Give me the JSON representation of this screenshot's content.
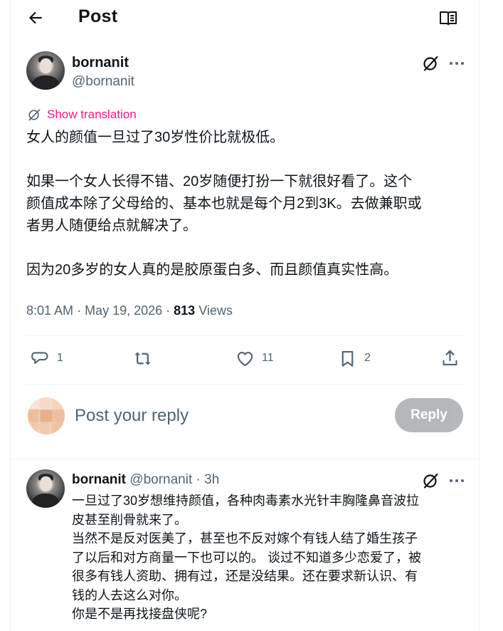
{
  "header": {
    "title": "Post"
  },
  "post": {
    "author_name": "bornanit",
    "author_handle": "@bornanit",
    "translate_label": "Show translation",
    "paragraphs": [
      [
        "女人的颜值一旦过了30岁性价比就极低。"
      ],
      [
        "如果一个女人长得不错、20岁随便打扮一下就很好看了。这个",
        "颜值成本除了父母给的、基本也就是每个月2到3K。去做兼职或",
        "者男人随便给点就解决了。"
      ],
      [
        "因为20多岁的女人真的是胶原蛋白多、而且颜值真实性高。"
      ]
    ],
    "time": "8:01 AM",
    "date": "May 19, 2026",
    "views_count": "813",
    "views_label": "Views",
    "stats": {
      "replies": "1",
      "reposts": "",
      "likes": "11",
      "bookmarks": "2"
    }
  },
  "reply_box": {
    "placeholder": "Post your reply",
    "button_label": "Reply"
  },
  "reply": {
    "author_name": "bornanit",
    "author_handle": "@bornanit",
    "time": "3h",
    "lines": [
      "一旦过了30岁想维持颜值，各种肉毒素水光针丰胸隆鼻音波拉",
      "皮甚至削骨就来了。",
      "当然不是反对医美了，甚至也不反对嫁个有钱人结了婚生孩子",
      "了以后和对方商量一下也可以的。 谈过不知道多少恋爱了，被",
      "很多有钱人资助、拥有过，还是没结果。还在要求新认识、有",
      "钱的人去这么对你。",
      "你是不是再找接盘侠呢?"
    ]
  },
  "colors": {
    "accent_pink": "#f91880",
    "secondary_text": "#536471",
    "reply_button": "#8f9295"
  },
  "icons": [
    "back-arrow-icon",
    "reader-mode-icon",
    "grok-icon",
    "more-icon",
    "translate-icon",
    "reply-icon",
    "repost-icon",
    "like-icon",
    "bookmark-icon",
    "share-icon"
  ]
}
